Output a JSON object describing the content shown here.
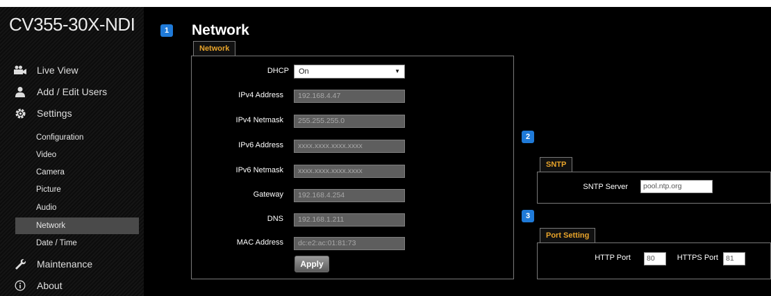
{
  "sidebar": {
    "model": "CV355-30X-NDI",
    "nav": [
      {
        "label": "Live View",
        "icon": "video-camera-icon"
      },
      {
        "label": "Add / Edit Users",
        "icon": "user-icon"
      },
      {
        "label": "Settings",
        "icon": "gear-icon"
      },
      {
        "label": "Maintenance",
        "icon": "wrench-icon"
      },
      {
        "label": "About",
        "icon": "info-icon"
      }
    ],
    "settings_items": [
      "Configuration",
      "Video",
      "Camera",
      "Picture",
      "Audio",
      "Network",
      "Date / Time"
    ],
    "active_item": "Network"
  },
  "badges": [
    "1",
    "2",
    "3"
  ],
  "page_title": "Network",
  "network": {
    "tab": "Network",
    "dhcp_label": "DHCP",
    "dhcp_value": "On",
    "fields": [
      {
        "label": "IPv4 Address",
        "value": "192.168.4.47"
      },
      {
        "label": "IPv4 Netmask",
        "value": "255.255.255.0"
      },
      {
        "label": "IPv6 Address",
        "value": "xxxx.xxxx.xxxx.xxxx"
      },
      {
        "label": "IPv6 Netmask",
        "value": "xxxx.xxxx.xxxx.xxxx"
      },
      {
        "label": "Gateway",
        "value": "192.168.4.254"
      },
      {
        "label": "DNS",
        "value": "192.168.1.211"
      },
      {
        "label": "MAC Address",
        "value": "dc:e2:ac:01:81:73"
      }
    ],
    "apply": "Apply"
  },
  "sntp": {
    "tab": "SNTP",
    "label": "SNTP Server",
    "value": "pool.ntp.org"
  },
  "port": {
    "tab": "Port Setting",
    "http_label": "HTTP Port",
    "http_value": "80",
    "https_label": "HTTPS Port",
    "https_value": "81"
  },
  "colors": {
    "accent": "#e8a42a",
    "badge": "#1f7ad8",
    "active_row": "#4a4a4a"
  }
}
